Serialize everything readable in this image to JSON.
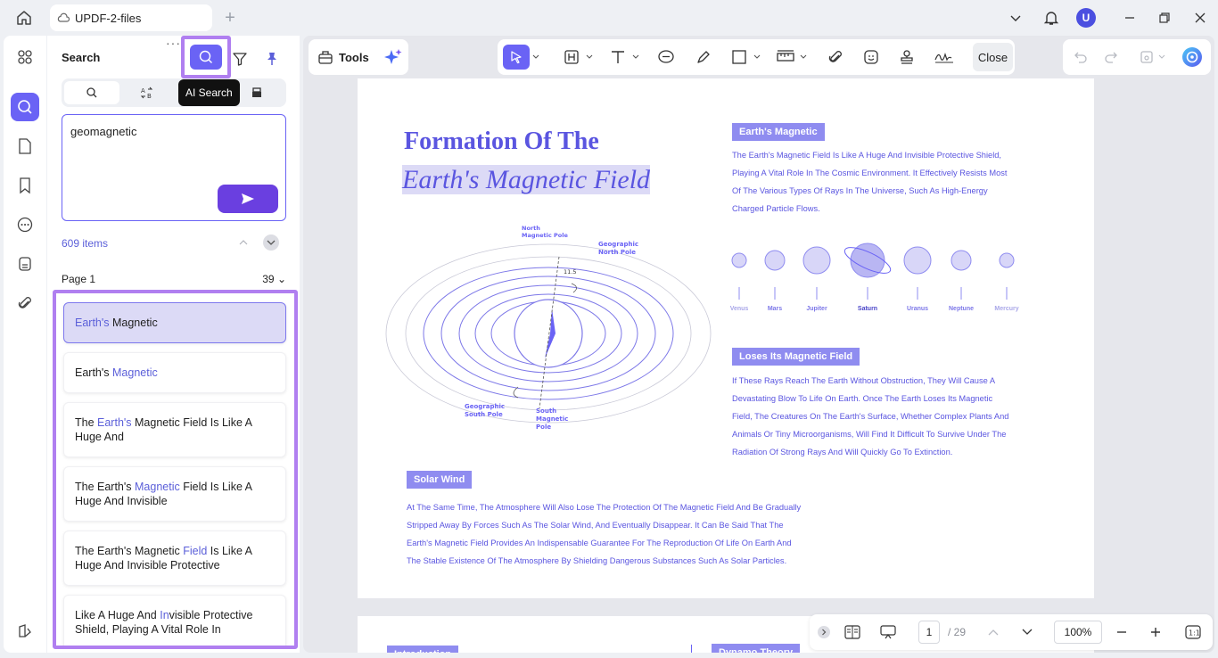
{
  "window": {
    "tab_title": "UPDF-2-files",
    "avatar_letter": "U"
  },
  "search_panel": {
    "title": "Search",
    "tooltip": "AI Search",
    "query": "geomagnetic",
    "count": "609 items",
    "page_label": "Page 1",
    "page_count": "39",
    "results": [
      {
        "pre": "",
        "hl": "Earth's",
        "post": " Magnetic",
        "active": true
      },
      {
        "pre": "Earth's ",
        "hl": "Magnetic",
        "post": "",
        "active": false
      },
      {
        "pre": "The ",
        "hl": "Earth's",
        "post": " Magnetic Field Is Like A Huge And",
        "active": false
      },
      {
        "pre": "The Earth's ",
        "hl": "Magnetic",
        "post": " Field Is Like A Huge And Invisible",
        "active": false
      },
      {
        "pre": "The Earth's Magnetic ",
        "hl": "Field",
        "post": " Is Like A Huge And Invisible Protective",
        "active": false
      },
      {
        "pre": "Like A Huge And ",
        "hl": "In",
        "post": "visible Protective Shield, Playing A Vital Role In",
        "active": false
      }
    ]
  },
  "toolbar": {
    "tools_label": "Tools",
    "close_label": "Close"
  },
  "document": {
    "title_line1": "Formation Of The",
    "title_line2": "Earth's Magnetic Field",
    "section1_tag": "Earth's Magnetic",
    "section1_lines": [
      "The Earth's Magnetic Field Is Like A Huge And Invisible Protective Shield,",
      "Playing A Vital Role In The Cosmic Environment. It Effectively Resists Most",
      "Of The Various Types Of Rays In The Universe, Such As High-Energy",
      "Charged Particle Flows."
    ],
    "planets": [
      "Venus",
      "Mars",
      "Jupiter",
      "Saturn",
      "Uranus",
      "Neptune",
      "Mercury"
    ],
    "section2_tag": "Loses Its Magnetic Field",
    "section2_lines": [
      "If These Rays Reach The Earth Without Obstruction, They Will Cause A",
      "Devastating Blow To Life On Earth. Once The Earth Loses Its Magnetic",
      "Field, The Creatures On The Earth's Surface, Whether Complex Plants And",
      "Animals Or Tiny Microorganisms, Will Find It Difficult To Survive Under The",
      "Radiation Of Strong Rays And Will Quickly Go To Extinction."
    ],
    "section3_tag": "Solar Wind",
    "section3_lines": [
      "At The Same Time, The Atmosphere Will Also Lose The Protection Of The Magnetic Field And Be Gradually",
      "Stripped Away By Forces Such As The Solar Wind, And Eventually Disappear. It Can Be Said That The",
      "Earth's Magnetic Field Provides An Indispensable Guarantee For The Reproduction Of Life On Earth And",
      "The Stable Existence Of The Atmosphere By Shielding Dangerous Substances Such As Solar Particles."
    ],
    "diagram_labels": {
      "north_magnetic": "North Magnetic Pole",
      "geo_north": "Geographic North Pole",
      "angle": "11.5",
      "geo_south": "Geographic South Pole",
      "south_magnetic": "South Magnetic Pole"
    },
    "page2_tag_left": "Introduction",
    "page2_tag_right": "Dynamo Theory"
  },
  "statusbar": {
    "current_page": "1",
    "total_pages": "/ 29",
    "zoom": "100%"
  }
}
